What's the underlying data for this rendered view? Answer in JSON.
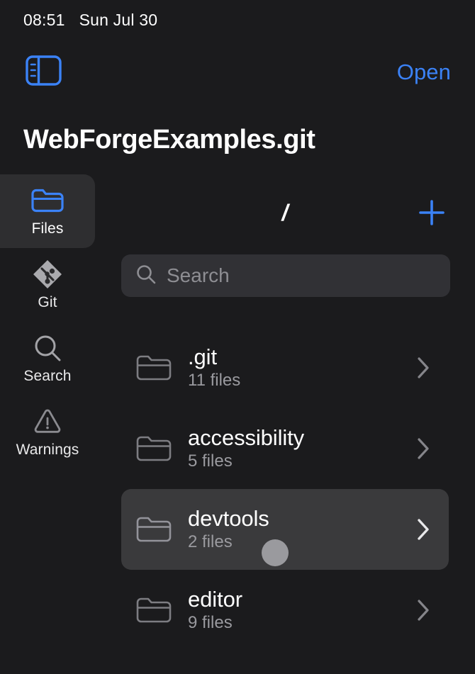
{
  "status_bar": {
    "time": "08:51",
    "date": "Sun Jul 30"
  },
  "nav": {
    "sidebar_toggle_icon": "sidebar-panel-icon",
    "open_label": "Open"
  },
  "header": {
    "title": "WebForgeExamples.git"
  },
  "rail": {
    "items": [
      {
        "label": "Files",
        "icon": "folder-icon",
        "selected": true
      },
      {
        "label": "Git",
        "icon": "git-branch-icon",
        "selected": false
      },
      {
        "label": "Search",
        "icon": "magnifier-icon",
        "selected": false
      },
      {
        "label": "Warnings",
        "icon": "warning-triangle-icon",
        "selected": false
      }
    ]
  },
  "toolbar": {
    "path": "/",
    "add_icon": "plus-icon"
  },
  "search": {
    "placeholder": "Search",
    "value": "",
    "icon": "magnifier-icon"
  },
  "files": [
    {
      "name": ".git",
      "meta": "11 files",
      "icon": "folder-icon",
      "chevron": "chevron-right-icon",
      "selected": false
    },
    {
      "name": "accessibility",
      "meta": "5 files",
      "icon": "folder-icon",
      "chevron": "chevron-right-icon",
      "selected": false
    },
    {
      "name": "devtools",
      "meta": "2 files",
      "icon": "folder-icon",
      "chevron": "chevron-right-icon",
      "selected": true
    },
    {
      "name": "editor",
      "meta": "9 files",
      "icon": "folder-icon",
      "chevron": "chevron-right-icon",
      "selected": false
    }
  ],
  "colors": {
    "background": "#1b1b1d",
    "accent": "#3b82f6",
    "selected_row": "#3a3a3c",
    "rail_selected": "#2e2e30",
    "search_field": "#313135",
    "secondary_text": "#9a9a9f",
    "touch_indicator": "#9a9a9e"
  }
}
